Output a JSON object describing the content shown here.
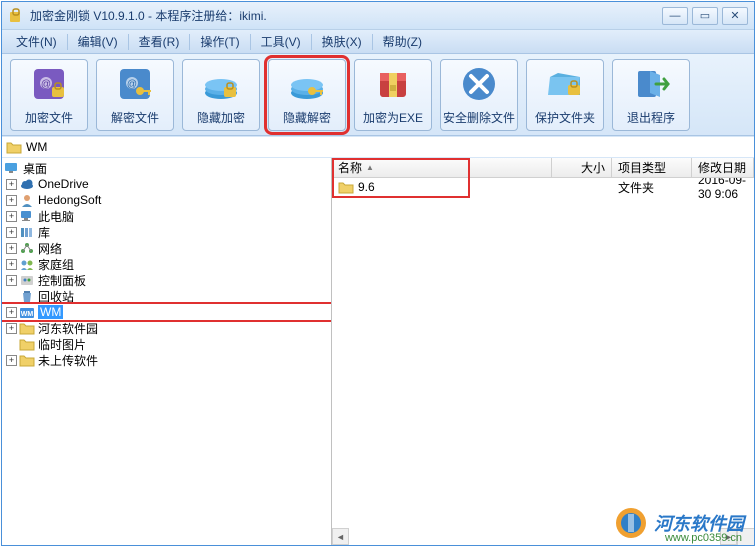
{
  "window": {
    "title": "加密金刚锁 V10.9.1.0 - 本程序注册给：ikimi."
  },
  "menubar": [
    {
      "label": "文件(N)"
    },
    {
      "label": "编辑(V)"
    },
    {
      "label": "查看(R)"
    },
    {
      "label": "操作(T)"
    },
    {
      "label": "工具(V)"
    },
    {
      "label": "换肤(X)"
    },
    {
      "label": "帮助(Z)"
    }
  ],
  "toolbar": [
    {
      "label": "加密文件",
      "icon": "book-lock"
    },
    {
      "label": "解密文件",
      "icon": "book-key"
    },
    {
      "label": "隐藏加密",
      "icon": "drive-lock"
    },
    {
      "label": "隐藏解密",
      "icon": "drive-key",
      "highlighted": true
    },
    {
      "label": "加密为EXE",
      "icon": "archive"
    },
    {
      "label": "安全删除文件",
      "icon": "delete"
    },
    {
      "label": "保护文件夹",
      "icon": "folder-lock"
    },
    {
      "label": "退出程序",
      "icon": "exit"
    }
  ],
  "path": {
    "label": "WM"
  },
  "tree": {
    "root": {
      "label": "桌面",
      "icon": "desktop"
    },
    "items": [
      {
        "label": "OneDrive",
        "icon": "cloud",
        "exp": "+"
      },
      {
        "label": "HedongSoft",
        "icon": "user",
        "exp": "+"
      },
      {
        "label": "此电脑",
        "icon": "pc",
        "exp": "+"
      },
      {
        "label": "库",
        "icon": "library",
        "exp": "+"
      },
      {
        "label": "网络",
        "icon": "network",
        "exp": "+"
      },
      {
        "label": "家庭组",
        "icon": "homegroup",
        "exp": "+"
      },
      {
        "label": "控制面板",
        "icon": "control",
        "exp": "+"
      },
      {
        "label": "回收站",
        "icon": "recycle",
        "exp": ""
      },
      {
        "label": "WM",
        "icon": "folder-wm",
        "exp": "+",
        "selected": true,
        "highlighted": true
      },
      {
        "label": "河东软件园",
        "icon": "folder",
        "exp": "+"
      },
      {
        "label": "临时图片",
        "icon": "folder",
        "exp": ""
      },
      {
        "label": "未上传软件",
        "icon": "folder",
        "exp": "+"
      }
    ]
  },
  "list": {
    "columns": {
      "name": "名称",
      "size": "大小",
      "type": "项目类型",
      "date": "修改日期"
    },
    "rows": [
      {
        "name": "9.6",
        "size": "",
        "type": "文件夹",
        "date": "2016-09-30 9:06",
        "highlighted": true
      }
    ]
  },
  "watermark": {
    "text": "河东软件园",
    "url": "www.pc0359.cn"
  }
}
